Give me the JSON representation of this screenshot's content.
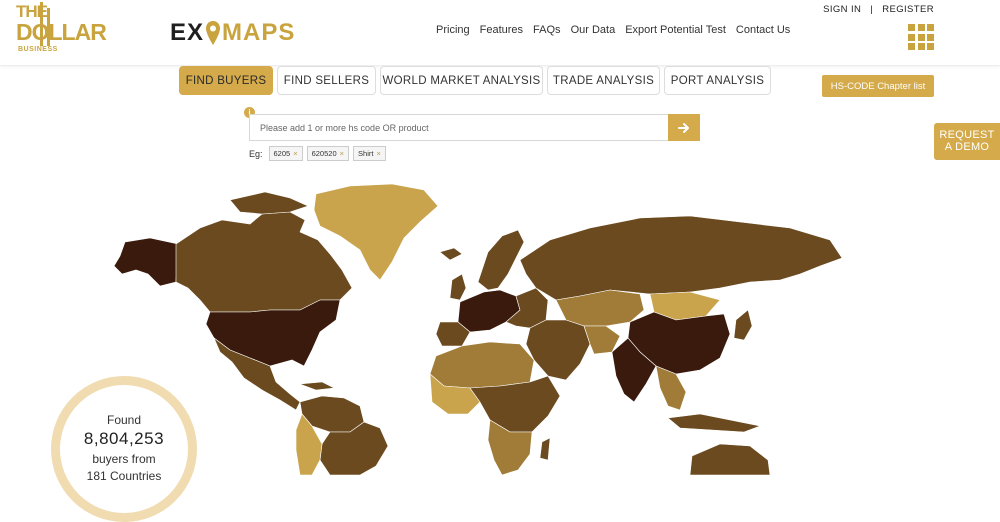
{
  "brand": {
    "tdb_line1": "THE",
    "tdb_line2": "DOLLAR",
    "tdb_line3": "BUSINESS",
    "eximaps_left": "EX",
    "eximaps_right": "MAPS"
  },
  "auth": {
    "sign_in": "SIGN IN",
    "separator": "|",
    "register": "REGISTER"
  },
  "nav": [
    "Pricing",
    "Features",
    "FAQs",
    "Our Data",
    "Export Potential Test",
    "Contact Us"
  ],
  "tabs": [
    {
      "label": "FIND BUYERS",
      "active": true
    },
    {
      "label": "FIND SELLERS",
      "active": false
    },
    {
      "label": "WORLD MARKET ANALYSIS",
      "active": false
    },
    {
      "label": "TRADE ANALYSIS",
      "active": false
    },
    {
      "label": "PORT ANALYSIS",
      "active": false
    }
  ],
  "hs_chapter_button": "HS-CODE Chapter list",
  "request_demo": {
    "line1": "REQUEST",
    "line2": "A DEMO"
  },
  "search": {
    "placeholder": "Please add 1 or more hs code OR product",
    "value": ""
  },
  "examples": {
    "label": "Eg:",
    "chips": [
      "6205",
      "620520",
      "Shirt"
    ]
  },
  "counter": {
    "found": "Found",
    "number": "8,804,253",
    "buyers_from": "buyers from",
    "countries": "181 Countries"
  },
  "colors": {
    "accent": "#d4aa4a",
    "map_dark": "#3a1a0c",
    "map_mid": "#6b4a20",
    "map_light": "#c9a44c"
  }
}
